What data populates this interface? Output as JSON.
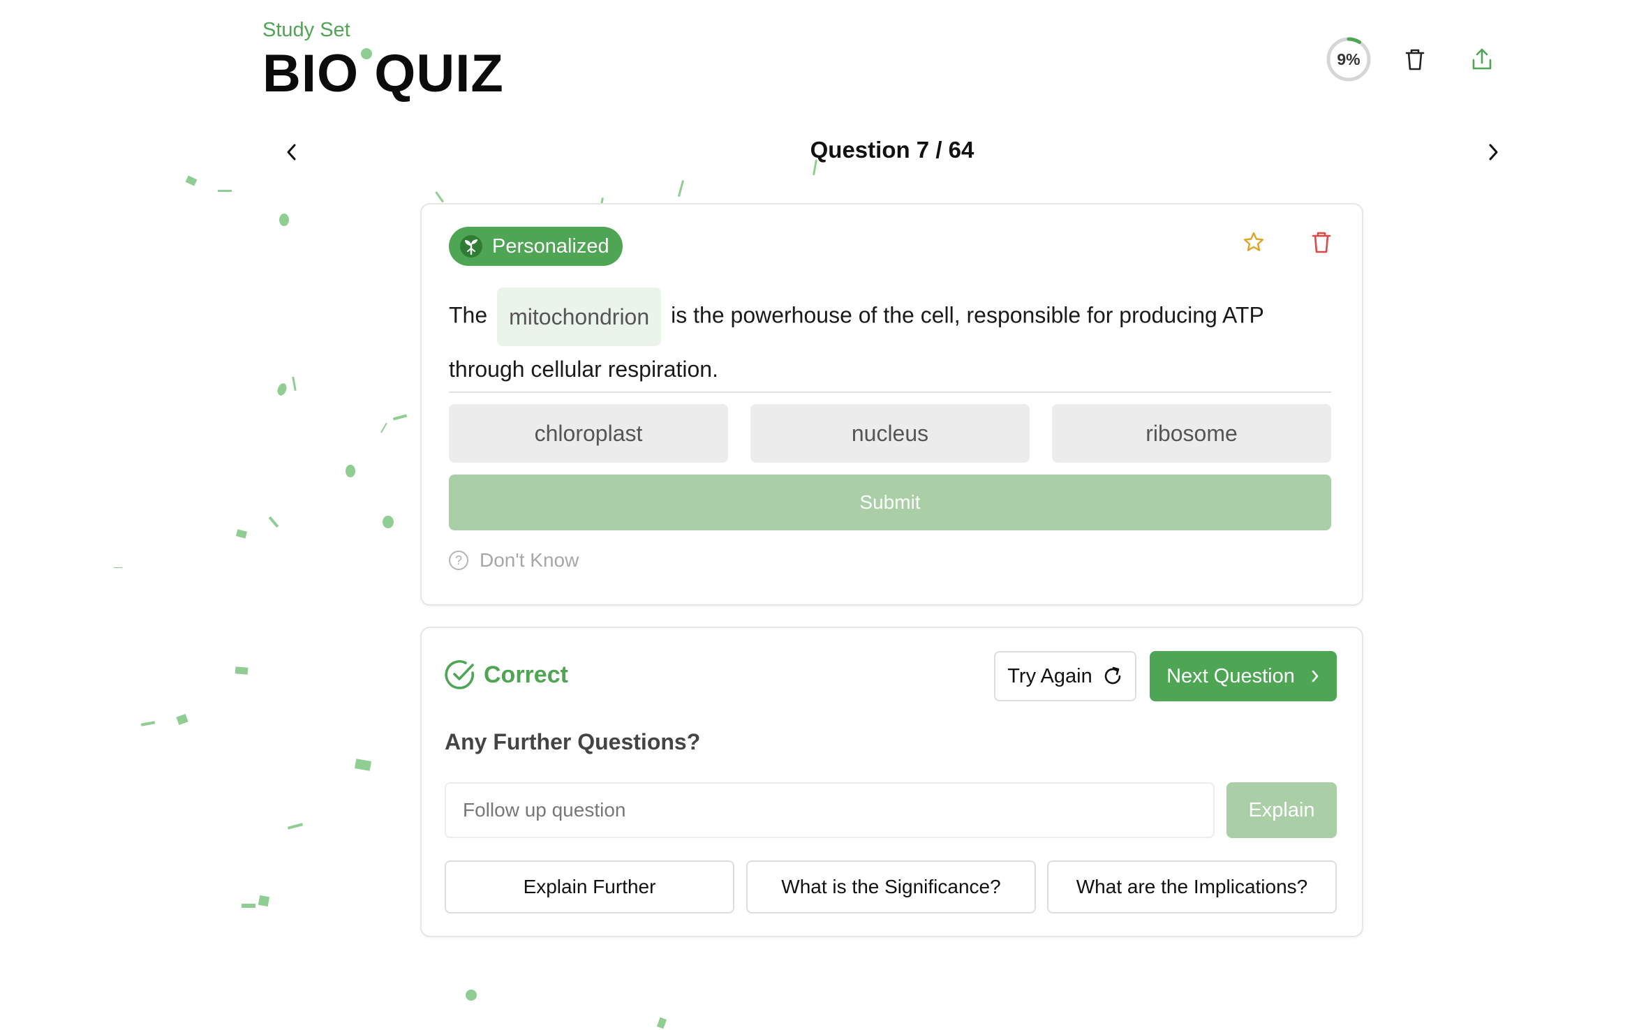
{
  "header": {
    "study_set_label": "Study Set",
    "title": "BIO QUIZ",
    "progress_percent": 9,
    "progress_text": "9%",
    "delete_icon": "trash-icon",
    "share_icon": "share-upload-icon"
  },
  "navigation": {
    "prev_icon": "chevron-left-icon",
    "next_icon": "chevron-right-icon",
    "question_counter": "Question 7 / 64"
  },
  "question_card": {
    "badge_label": "Personalized",
    "badge_icon": "brain-sprout-icon",
    "favorite_icon": "star-icon",
    "delete_icon": "trash-icon",
    "sentence_before": "The",
    "blank_answer": "mitochondrion",
    "sentence_after": "is the powerhouse of the cell, responsible for producing ATP through cellular respiration.",
    "options": [
      "chloroplast",
      "nucleus",
      "ribosome"
    ],
    "submit_label": "Submit",
    "dont_know_label": "Don't Know"
  },
  "result_card": {
    "status_label": "Correct",
    "try_again_label": "Try Again",
    "next_question_label": "Next Question",
    "further_title": "Any Further Questions?",
    "follow_up_placeholder": "Follow up question",
    "explain_label": "Explain",
    "suggestions": [
      "Explain Further",
      "What is the Significance?",
      "What are the Implications?"
    ]
  },
  "colors": {
    "accent": "#4ea553",
    "accent_light": "#aacfa6",
    "favorite": "#e0a526",
    "danger": "#e04747"
  }
}
